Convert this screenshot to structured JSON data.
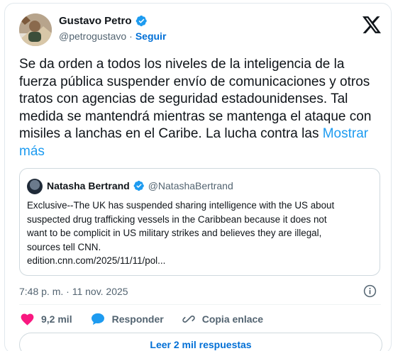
{
  "tweet": {
    "author_name": "Gustavo Petro",
    "handle": "@petrogustavo",
    "separator": "·",
    "follow_label": "Seguir",
    "text": "Se da orden a todos los niveles de la inteligencia de la fuerza pública suspender envío de comunicaciones y otros tratos con agencias de seguridad estadounidenses. Tal medida se mantendrá mientras se mantenga el ataque con misiles a lanchas en el Caribe. La lucha contra las",
    "show_more_label": "Mostrar más",
    "timestamp": "7:48 p. m. · 11 nov. 2025"
  },
  "quote": {
    "author_name": "Natasha Bertrand",
    "handle": "@NatashaBertrand",
    "text_lines": [
      "Exclusive--The UK has suspended sharing intelligence with the US about",
      "suspected drug trafficking vessels in the Caribbean because it does not",
      "want to be complicit in US military strikes and believes they are illegal,",
      "sources tell CNN.",
      "edition.cnn.com/2025/11/11/pol..."
    ]
  },
  "actions": {
    "likes": "9,2 mil",
    "reply_label": "Responder",
    "copy_link_label": "Copia enlace"
  },
  "read_replies_label": "Leer 2 mil respuestas",
  "icons": [
    "avatar",
    "verified-badge-icon",
    "x-logo-icon",
    "info-icon",
    "heart-icon",
    "reply-icon",
    "link-icon"
  ],
  "colors": {
    "link": "#1d9bf0",
    "follow": "#006fd6",
    "verified": "#1d9bf0",
    "like": "#f91880",
    "reply": "#1d9bf0",
    "secondary_text": "#536471"
  }
}
